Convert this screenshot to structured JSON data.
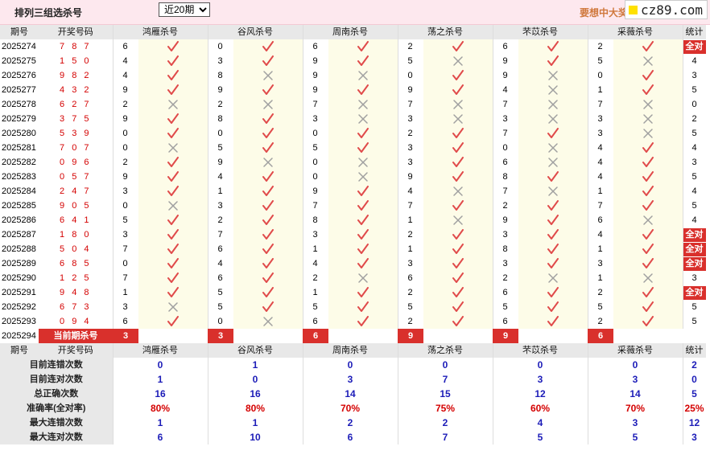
{
  "header": {
    "title": "排列三组选杀号",
    "period_select": "近20期",
    "promo": "要想中大奖",
    "logo": "cz89.com"
  },
  "columns": {
    "issue": "期号",
    "draw": "开奖号码",
    "experts": [
      "鸿雁杀号",
      "谷风杀号",
      "周南杀号",
      "荡之杀号",
      "芣苡杀号",
      "采薇杀号"
    ],
    "stat": "统计"
  },
  "rows": [
    {
      "issue": "2025274",
      "draw": "787",
      "kills": [
        6,
        0,
        6,
        2,
        6,
        2
      ],
      "ok": [
        1,
        1,
        1,
        1,
        1,
        1
      ],
      "stat": "全对"
    },
    {
      "issue": "2025275",
      "draw": "150",
      "kills": [
        4,
        3,
        9,
        5,
        9,
        5
      ],
      "ok": [
        1,
        1,
        1,
        0,
        1,
        0
      ],
      "stat": "4"
    },
    {
      "issue": "2025276",
      "draw": "982",
      "kills": [
        4,
        8,
        9,
        0,
        9,
        0
      ],
      "ok": [
        1,
        0,
        0,
        1,
        0,
        1
      ],
      "stat": "3"
    },
    {
      "issue": "2025277",
      "draw": "432",
      "kills": [
        9,
        9,
        9,
        9,
        4,
        1
      ],
      "ok": [
        1,
        1,
        1,
        1,
        0,
        1
      ],
      "stat": "5"
    },
    {
      "issue": "2025278",
      "draw": "627",
      "kills": [
        2,
        2,
        7,
        7,
        7,
        7
      ],
      "ok": [
        0,
        0,
        0,
        0,
        0,
        0
      ],
      "stat": "0"
    },
    {
      "issue": "2025279",
      "draw": "375",
      "kills": [
        9,
        8,
        3,
        3,
        3,
        3
      ],
      "ok": [
        1,
        1,
        0,
        0,
        0,
        0
      ],
      "stat": "2"
    },
    {
      "issue": "2025280",
      "draw": "539",
      "kills": [
        0,
        0,
        0,
        2,
        7,
        3
      ],
      "ok": [
        1,
        1,
        1,
        1,
        1,
        0
      ],
      "stat": "5"
    },
    {
      "issue": "2025281",
      "draw": "707",
      "kills": [
        0,
        5,
        5,
        3,
        0,
        4
      ],
      "ok": [
        0,
        1,
        1,
        1,
        0,
        1
      ],
      "stat": "4"
    },
    {
      "issue": "2025282",
      "draw": "096",
      "kills": [
        2,
        9,
        0,
        3,
        6,
        4
      ],
      "ok": [
        1,
        0,
        0,
        1,
        0,
        1
      ],
      "stat": "3"
    },
    {
      "issue": "2025283",
      "draw": "057",
      "kills": [
        9,
        4,
        0,
        9,
        8,
        4
      ],
      "ok": [
        1,
        1,
        0,
        1,
        1,
        1
      ],
      "stat": "5"
    },
    {
      "issue": "2025284",
      "draw": "247",
      "kills": [
        3,
        1,
        9,
        4,
        7,
        1
      ],
      "ok": [
        1,
        1,
        1,
        0,
        0,
        1
      ],
      "stat": "4"
    },
    {
      "issue": "2025285",
      "draw": "905",
      "kills": [
        0,
        3,
        7,
        7,
        2,
        7
      ],
      "ok": [
        0,
        1,
        1,
        1,
        1,
        1
      ],
      "stat": "5"
    },
    {
      "issue": "2025286",
      "draw": "641",
      "kills": [
        5,
        2,
        8,
        1,
        9,
        6
      ],
      "ok": [
        1,
        1,
        1,
        0,
        1,
        0
      ],
      "stat": "4"
    },
    {
      "issue": "2025287",
      "draw": "180",
      "kills": [
        3,
        7,
        3,
        2,
        3,
        4
      ],
      "ok": [
        1,
        1,
        1,
        1,
        1,
        1
      ],
      "stat": "全对"
    },
    {
      "issue": "2025288",
      "draw": "504",
      "kills": [
        7,
        6,
        1,
        1,
        8,
        1
      ],
      "ok": [
        1,
        1,
        1,
        1,
        1,
        1
      ],
      "stat": "全对"
    },
    {
      "issue": "2025289",
      "draw": "685",
      "kills": [
        0,
        4,
        4,
        3,
        3,
        3
      ],
      "ok": [
        1,
        1,
        1,
        1,
        1,
        1
      ],
      "stat": "全对"
    },
    {
      "issue": "2025290",
      "draw": "125",
      "kills": [
        7,
        6,
        2,
        6,
        2,
        1
      ],
      "ok": [
        1,
        1,
        0,
        1,
        0,
        0
      ],
      "stat": "3"
    },
    {
      "issue": "2025291",
      "draw": "948",
      "kills": [
        1,
        5,
        1,
        2,
        6,
        2
      ],
      "ok": [
        1,
        1,
        1,
        1,
        1,
        1
      ],
      "stat": "全对"
    },
    {
      "issue": "2025292",
      "draw": "673",
      "kills": [
        3,
        5,
        5,
        5,
        5,
        5
      ],
      "ok": [
        0,
        1,
        1,
        1,
        1,
        1
      ],
      "stat": "5"
    },
    {
      "issue": "2025293",
      "draw": "094",
      "kills": [
        6,
        0,
        6,
        2,
        6,
        2
      ],
      "ok": [
        1,
        0,
        1,
        1,
        1,
        1
      ],
      "stat": "5"
    }
  ],
  "current": {
    "issue": "2025294",
    "label": "当前期杀号",
    "kills": [
      "3",
      "3",
      "6",
      "9",
      "9",
      "6"
    ]
  },
  "summary": [
    {
      "label": "目前连错次数",
      "values": [
        "0",
        "1",
        "0",
        "0",
        "0",
        "0"
      ],
      "stat": "2"
    },
    {
      "label": "目前连对次数",
      "values": [
        "1",
        "0",
        "3",
        "7",
        "3",
        "3"
      ],
      "stat": "0"
    },
    {
      "label": "总正确次数",
      "values": [
        "16",
        "16",
        "14",
        "15",
        "12",
        "14"
      ],
      "stat": "5"
    },
    {
      "label": "准确率(全对率)",
      "values": [
        "80%",
        "80%",
        "70%",
        "75%",
        "60%",
        "70%"
      ],
      "stat": "25%"
    },
    {
      "label": "最大连错次数",
      "values": [
        "1",
        "1",
        "2",
        "2",
        "4",
        "3"
      ],
      "stat": "12"
    },
    {
      "label": "最大连对次数",
      "values": [
        "6",
        "10",
        "6",
        "7",
        "5",
        "5"
      ],
      "stat": "3"
    }
  ],
  "colors": {
    "accent_red": "#d9302c",
    "check": "#e04a4a",
    "cross": "#a0a0a0",
    "header_bg": "#e8e8e8",
    "summary_blue": "#1c1cb8"
  },
  "icons": {
    "check": "check-icon",
    "cross": "cross-icon"
  }
}
